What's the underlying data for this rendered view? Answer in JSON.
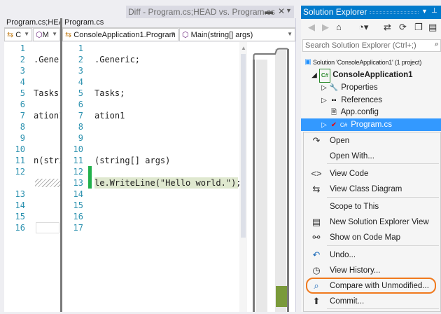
{
  "diff_tab": {
    "title": "Diff - Program.cs;HEAD vs. Program.cs",
    "pin_icon": "pin-icon",
    "close_icon": "close-icon"
  },
  "left_pane": {
    "header": "Program.cs;HEAD",
    "type_dropdown": "C",
    "member_dropdown": "M",
    "lines": [
      {
        "n": "1",
        "t": ""
      },
      {
        "n": "2",
        "t": ".Gene"
      },
      {
        "n": "3",
        "t": ""
      },
      {
        "n": "4",
        "t": ""
      },
      {
        "n": "5",
        "t": "Tasks;"
      },
      {
        "n": "6",
        "t": ""
      },
      {
        "n": "7",
        "t": "ation1"
      },
      {
        "n": "8",
        "t": ""
      },
      {
        "n": "9",
        "t": ""
      },
      {
        "n": "10",
        "t": ""
      },
      {
        "n": "11",
        "t": "n(stri"
      },
      {
        "n": "12",
        "t": ""
      },
      {
        "n": "",
        "t": ""
      },
      {
        "n": "13",
        "t": ""
      },
      {
        "n": "14",
        "t": ""
      },
      {
        "n": "15",
        "t": ""
      },
      {
        "n": "16",
        "t": ""
      }
    ]
  },
  "right_pane": {
    "header": "Program.cs",
    "type_dropdown": "ConsoleApplication1.Program",
    "member_dropdown": "Main(string[] args)",
    "lines": [
      {
        "n": "1",
        "t": ""
      },
      {
        "n": "2",
        "t": ".Generic;"
      },
      {
        "n": "3",
        "t": ""
      },
      {
        "n": "4",
        "t": ""
      },
      {
        "n": "5",
        "t": "Tasks;"
      },
      {
        "n": "6",
        "t": ""
      },
      {
        "n": "7",
        "t": "ation1"
      },
      {
        "n": "8",
        "t": ""
      },
      {
        "n": "9",
        "t": ""
      },
      {
        "n": "10",
        "t": ""
      },
      {
        "n": "11",
        "t": "(string[] args)"
      },
      {
        "n": "12",
        "t": ""
      },
      {
        "n": "13",
        "t": "le.WriteLine(\"Hello world.\");"
      },
      {
        "n": "14",
        "t": ""
      },
      {
        "n": "15",
        "t": ""
      },
      {
        "n": "16",
        "t": ""
      },
      {
        "n": "17",
        "t": ""
      }
    ]
  },
  "solution_explorer": {
    "title": "Solution Explorer",
    "search_placeholder": "Search Solution Explorer (Ctrl+;)",
    "tree": [
      "Solution 'ConsoleApplication1' (1 project)",
      "ConsoleApplication1",
      "Properties",
      "References",
      "App.config",
      "Program.cs"
    ]
  },
  "context_menu": {
    "items": [
      "Open",
      "Open With...",
      "View Code",
      "View Class Diagram",
      "Scope to This",
      "New Solution Explorer View",
      "Show on Code Map",
      "Undo...",
      "View History...",
      "Compare with Unmodified...",
      "Commit..."
    ],
    "highlighted": "Compare with Unmodified..."
  },
  "colors": {
    "accent": "#007acc",
    "selection": "#3399ff",
    "highlight_ring": "#f07a1e",
    "added_marker": "#22b14c",
    "diff_added": "#7a9a3a"
  }
}
